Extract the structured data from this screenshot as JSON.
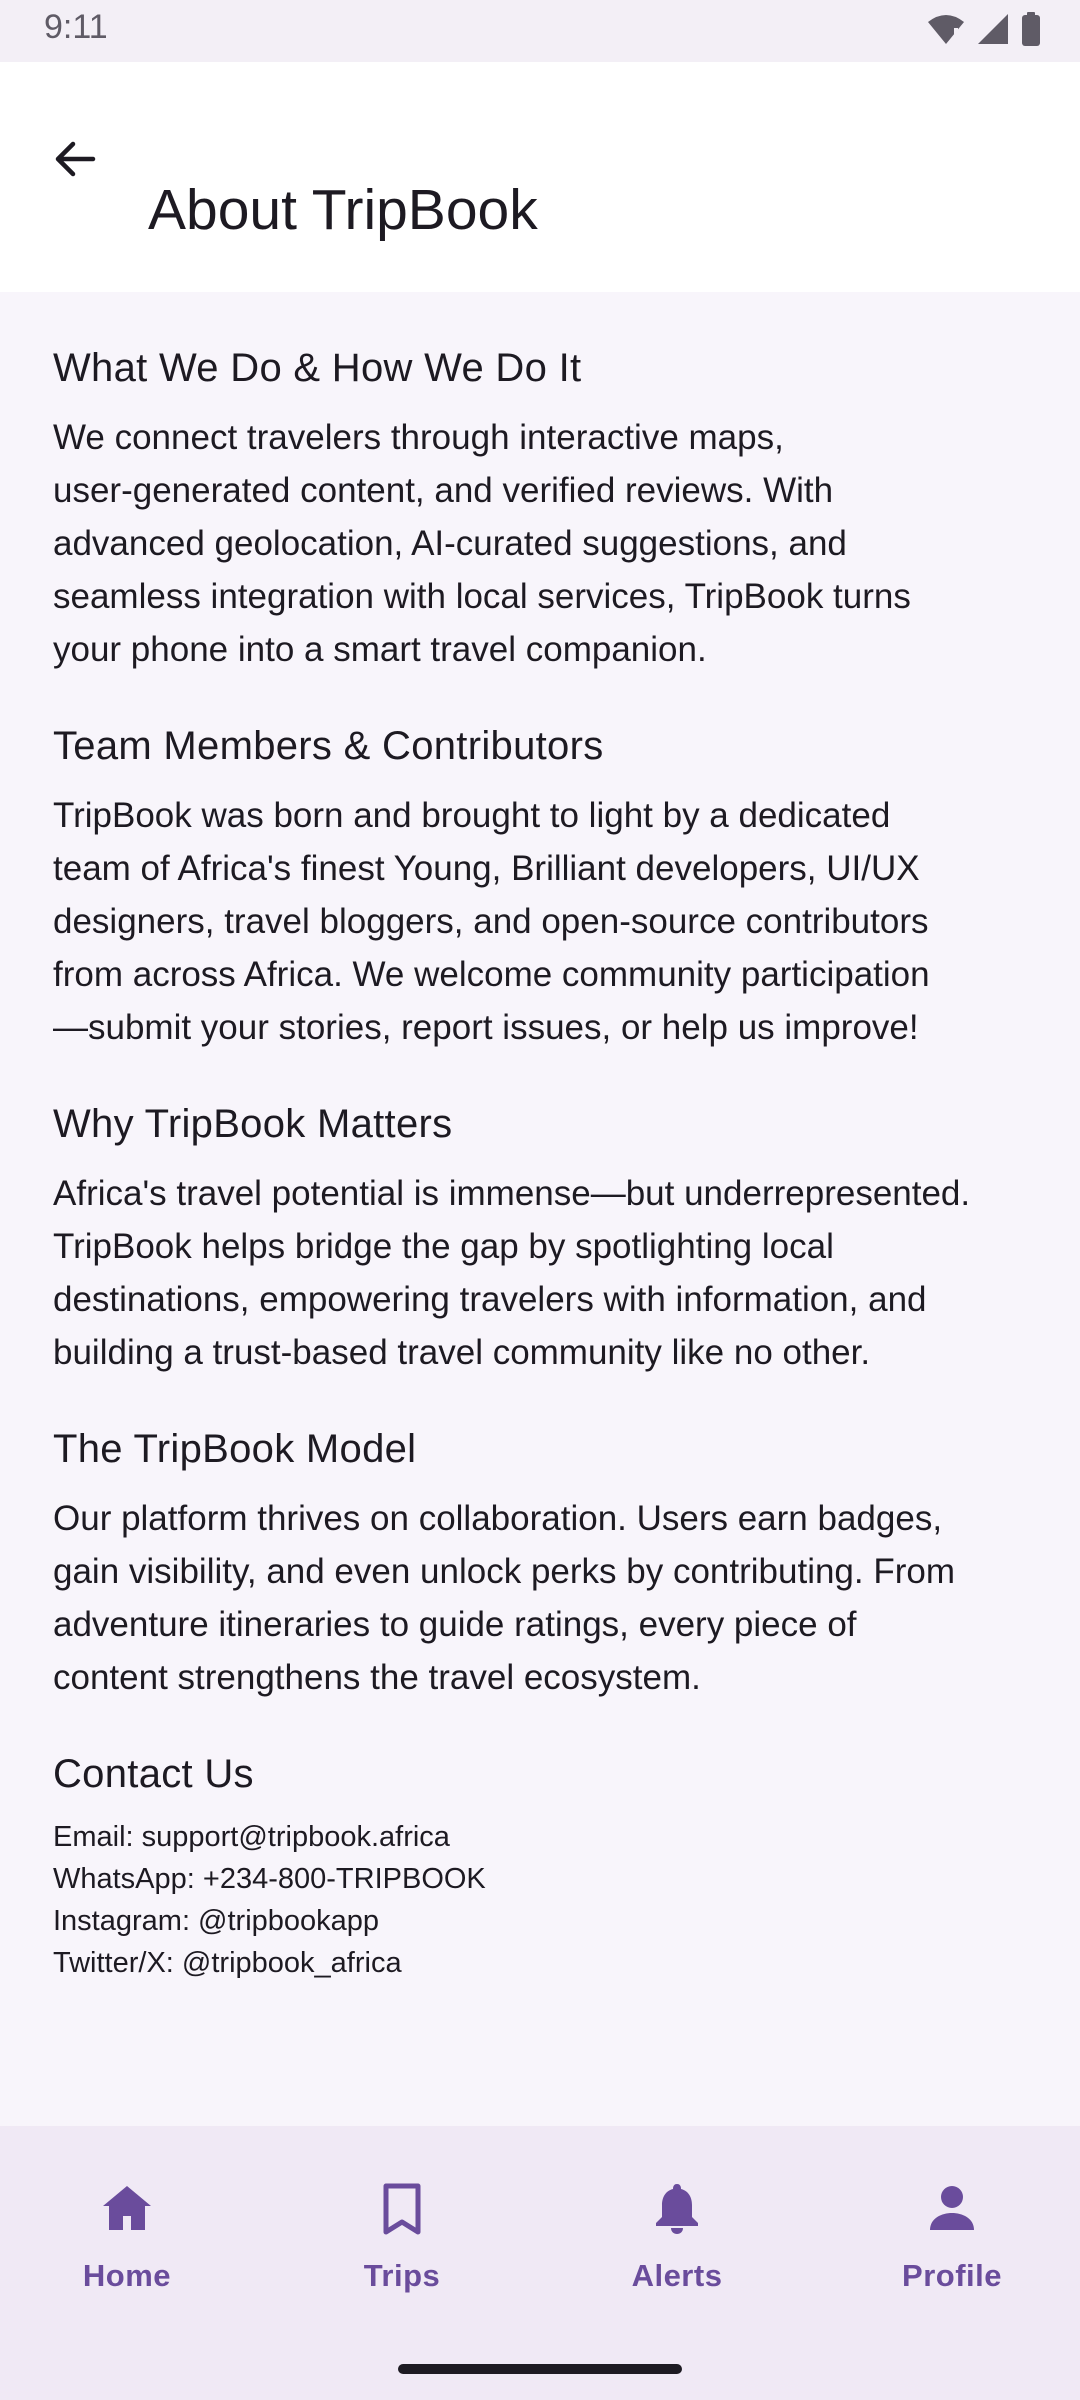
{
  "status_bar": {
    "time": "9:11",
    "icons": [
      "wifi-icon",
      "signal-icon",
      "battery-icon"
    ]
  },
  "app_bar": {
    "back_icon": "arrow-back-icon",
    "title": "About TripBook"
  },
  "sections": [
    {
      "title": "What We Do & How We Do It",
      "lines": [
        "We connect travelers through interactive maps,",
        "user-generated content, and verified reviews. With",
        "advanced geolocation, AI-curated suggestions, and",
        "seamless integration with local services, TripBook turns",
        "your phone into a smart travel companion."
      ]
    },
    {
      "title": "Team Members & Contributors",
      "lines": [
        "TripBook was born and brought to light by a dedicated",
        "team of Africa's finest Young, Brilliant developers, UI/UX",
        "designers, travel bloggers, and open-source contributors",
        "from across Africa. We welcome community participation",
        "—submit your stories, report issues, or help us improve!"
      ]
    },
    {
      "title": "Why TripBook Matters",
      "lines": [
        "Africa's travel potential is immense—but underrepresented.",
        "TripBook helps bridge the gap by spotlighting local",
        "destinations, empowering travelers with information, and",
        "building a trust-based travel community like no other."
      ]
    },
    {
      "title": "The TripBook Model",
      "lines": [
        "Our platform thrives on collaboration. Users earn badges,",
        "gain visibility, and even unlock perks by contributing. From",
        "adventure itineraries to guide ratings, every piece of",
        "content strengthens the travel ecosystem."
      ]
    }
  ],
  "contact": {
    "title": "Contact Us",
    "lines": [
      "Email: support@tripbook.africa",
      "WhatsApp: +234-800-TRIPBOOK",
      "Instagram: @tripbookapp",
      "Twitter/X: @tripbook_africa"
    ]
  },
  "bottom_nav": {
    "items": [
      {
        "label": "Home",
        "icon": "home-icon"
      },
      {
        "label": "Trips",
        "icon": "bookmark-icon"
      },
      {
        "label": "Alerts",
        "icon": "bell-icon"
      },
      {
        "label": "Profile",
        "icon": "person-icon"
      }
    ]
  },
  "colors": {
    "accent": "#6a4c9c",
    "background": "#f8f5fb",
    "app_bar": "#ffffff",
    "bottom_nav": "#f0e9f5",
    "text": "#1d1a22"
  }
}
